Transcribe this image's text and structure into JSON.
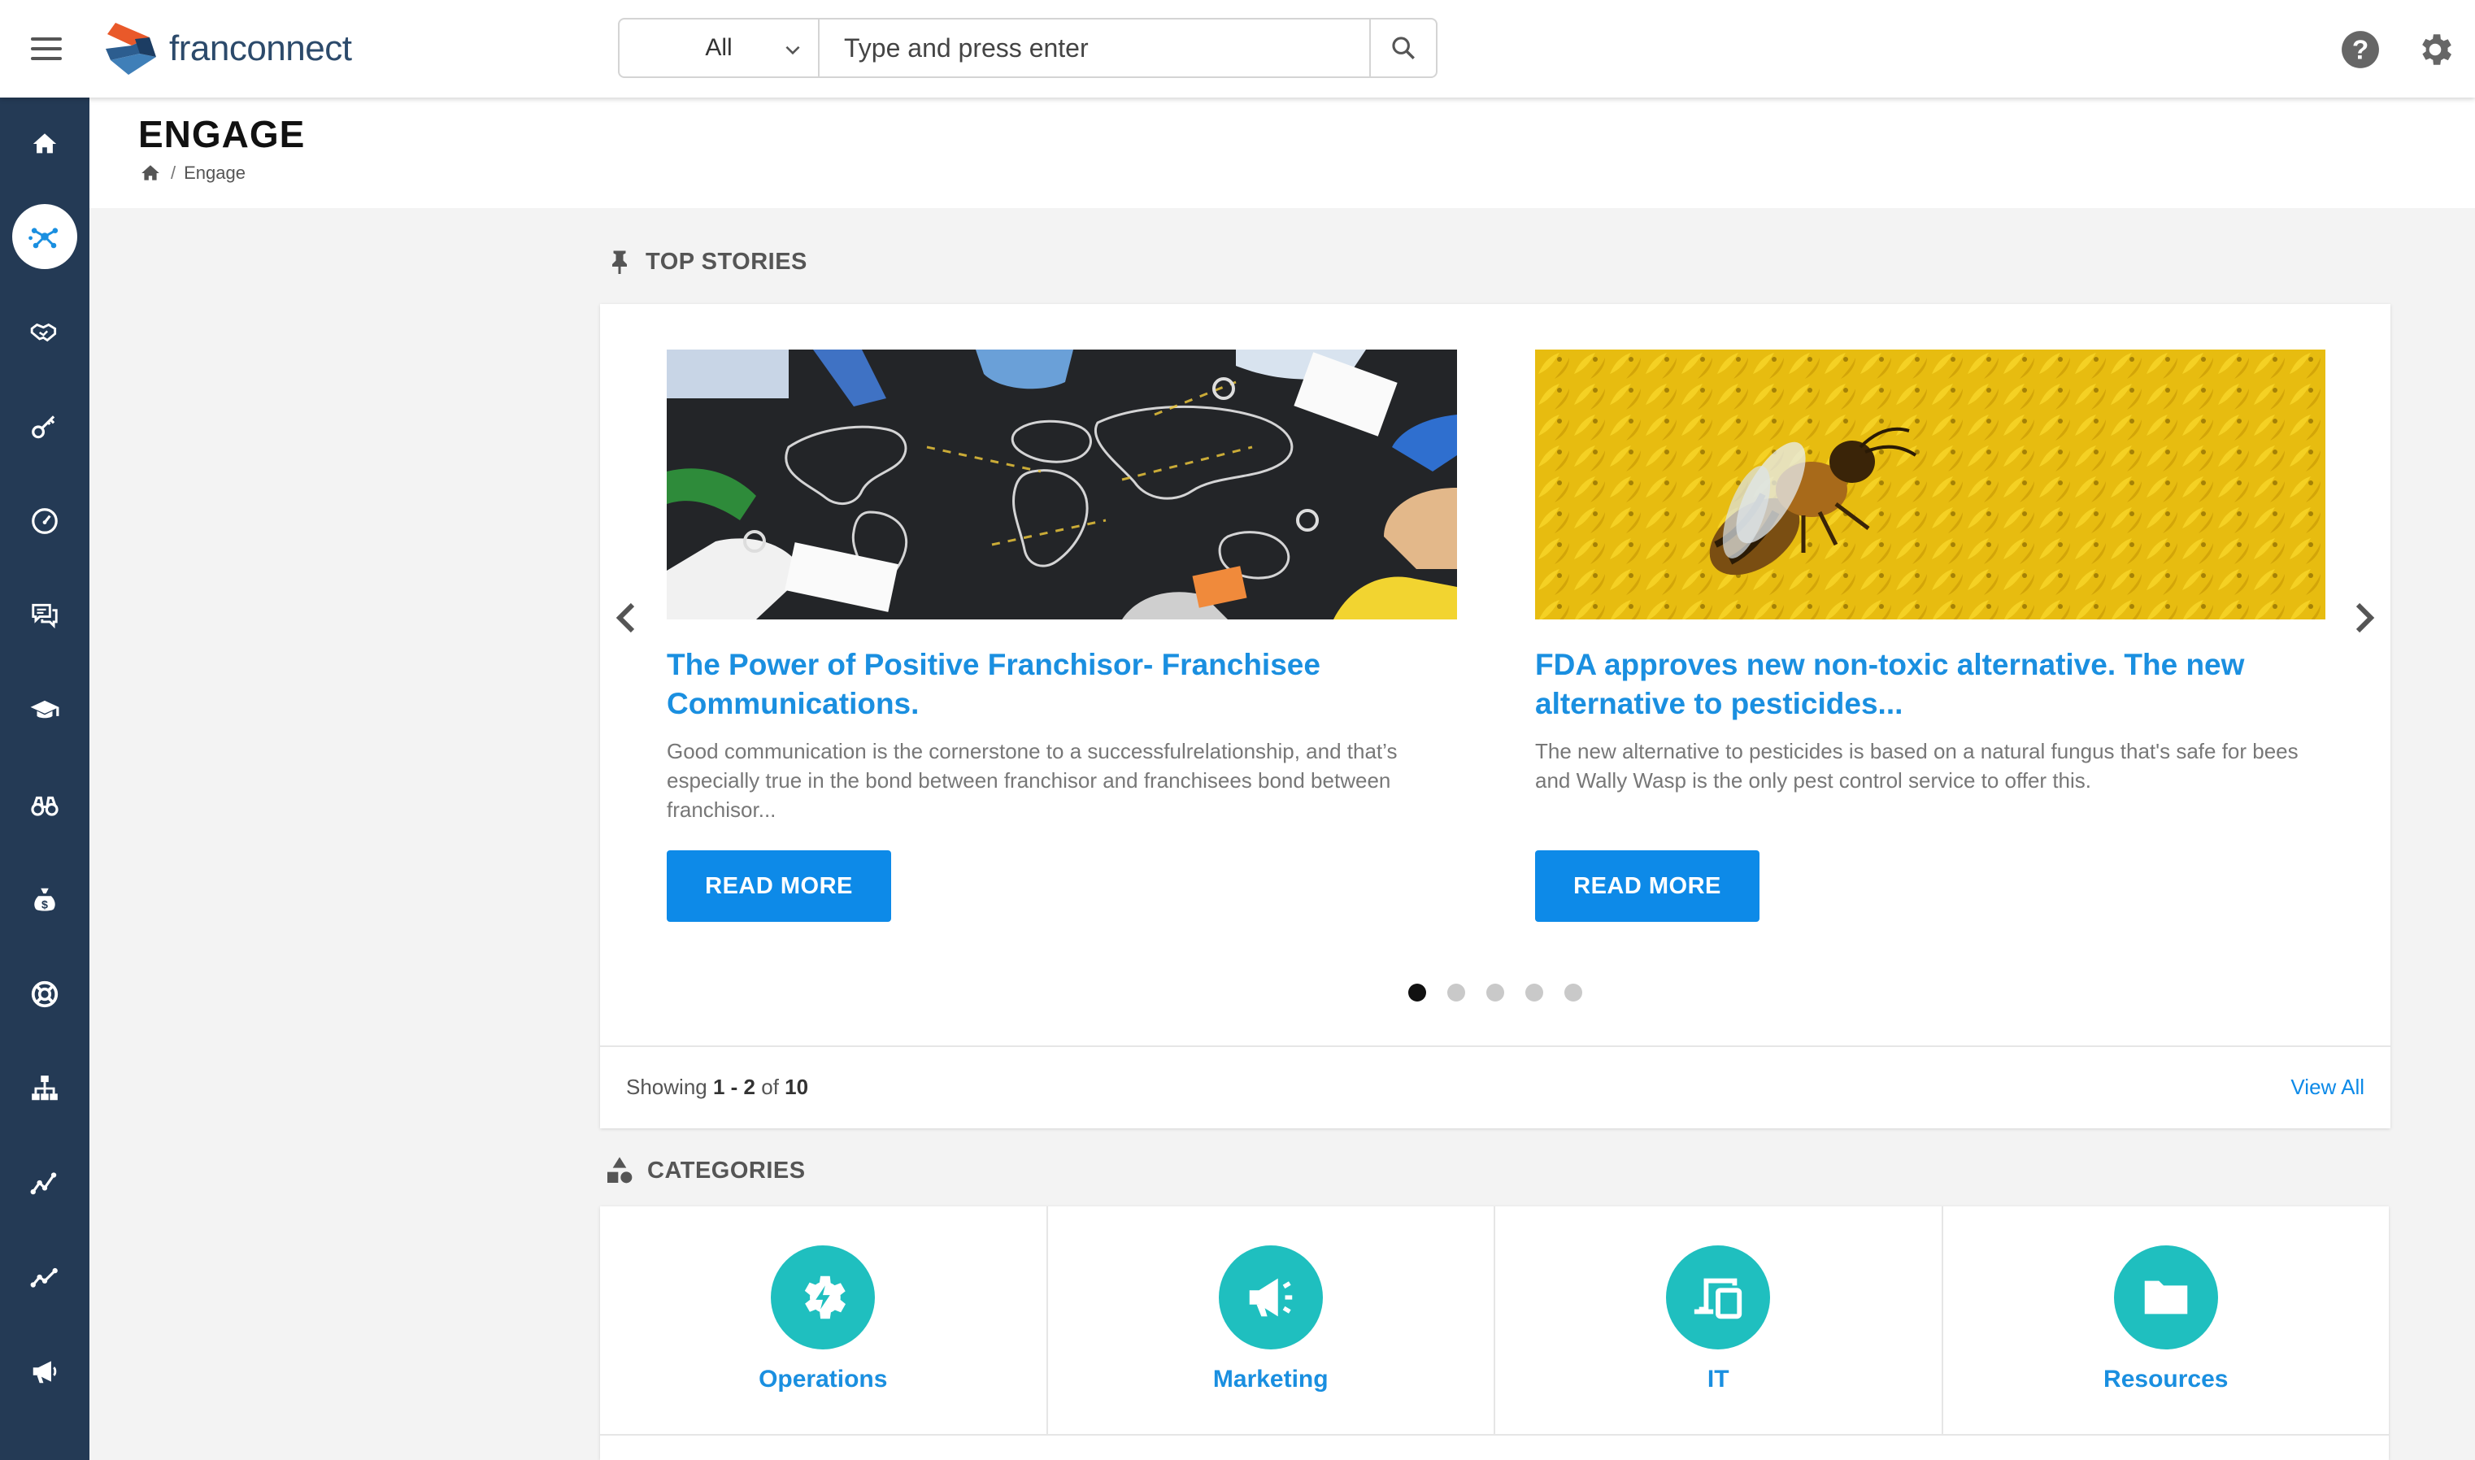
{
  "header": {
    "brand": "franconnect",
    "search": {
      "scope": "All",
      "placeholder": "Type and press enter"
    }
  },
  "sidebar": {
    "items": [
      {
        "icon": "home-icon"
      },
      {
        "icon": "engage-network-icon",
        "active": true
      },
      {
        "icon": "handshake-icon"
      },
      {
        "icon": "key-icon"
      },
      {
        "icon": "gauge-icon"
      },
      {
        "icon": "chat-icon"
      },
      {
        "icon": "graduation-cap-icon"
      },
      {
        "icon": "binoculars-icon"
      },
      {
        "icon": "money-bag-icon"
      },
      {
        "icon": "lifebuoy-icon"
      },
      {
        "icon": "org-chart-icon"
      },
      {
        "icon": "trend-line-icon"
      },
      {
        "icon": "analytics-line-icon"
      },
      {
        "icon": "megaphone-icon"
      }
    ]
  },
  "page": {
    "title": "ENGAGE",
    "breadcrumb": "Engage"
  },
  "top_stories": {
    "heading": "TOP STORIES",
    "stories": [
      {
        "title": "The Power of Positive Franchisor- Franchisee Communications.",
        "excerpt": "Good communication is the cornerstone to a successfulrelationship, and that’s especially true in the bond between franchisor and franchisees bond between franchisor...",
        "button": "READ MORE"
      },
      {
        "title": "FDA approves new non-toxic alternative. The new alternative to pesticides...",
        "excerpt": "The new alternative to pesticides is based on a natural fungus that's safe for bees and Wally Wasp is the only pest control service to offer this.",
        "button": "READ MORE"
      }
    ],
    "pagination": {
      "pages": 5,
      "current": 1
    },
    "showing": {
      "prefix": "Showing",
      "range": "1 - 2",
      "of": "of",
      "total": "10"
    },
    "view_all": "View All"
  },
  "categories": {
    "heading": "CATEGORIES",
    "items": [
      {
        "label": "Operations",
        "icon": "gear-bolt-icon"
      },
      {
        "label": "Marketing",
        "icon": "megaphone-icon"
      },
      {
        "label": "IT",
        "icon": "devices-icon"
      },
      {
        "label": "Resources",
        "icon": "folder-icon"
      }
    ]
  },
  "colors": {
    "sidebar": "#243a55",
    "accent": "#0d8ae8",
    "title_blue": "#1a8fe0",
    "category_teal": "#1fbfbf"
  }
}
